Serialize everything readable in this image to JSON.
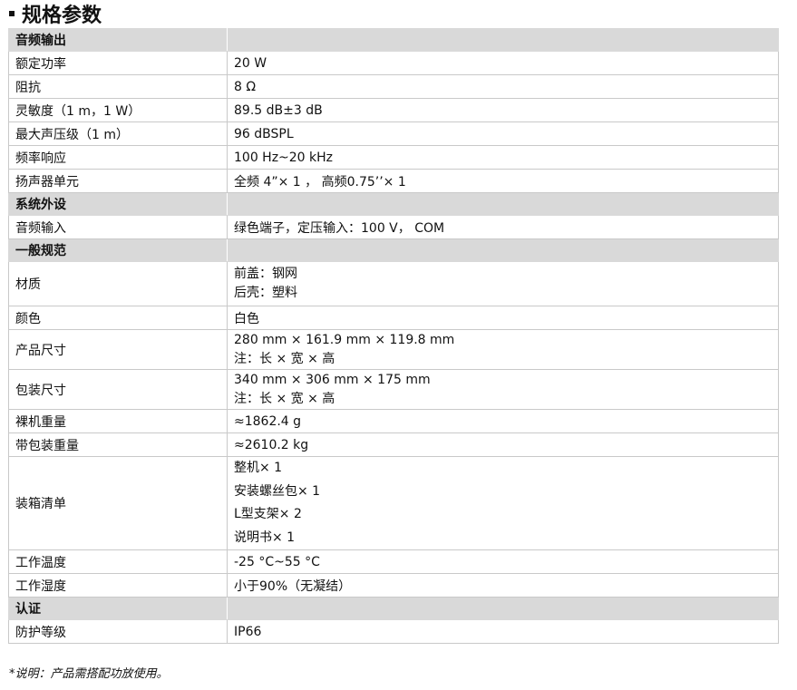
{
  "title": "规格参数",
  "sections": {
    "audio": {
      "header": "音频输出",
      "rated_power": {
        "label": "额定功率",
        "value": "20 W"
      },
      "impedance": {
        "label": "阻抗",
        "value": "8 Ω"
      },
      "sensitivity": {
        "label": "灵敏度（1 m，1 W）",
        "value": "89.5 dB±3 dB"
      },
      "max_spl": {
        "label": "最大声压级（1 m）",
        "value": "96 dBSPL"
      },
      "freq_response": {
        "label": "频率响应",
        "value": "100 Hz~20 kHz"
      },
      "speaker_unit": {
        "label": "扬声器单元",
        "value": "全频  4”× 1  ，  高频0.75’’× 1"
      }
    },
    "system": {
      "header": "系统外设",
      "audio_input": {
        "label": "音频输入",
        "value": "绿色端子，定压输入：100 V，  COM"
      }
    },
    "general": {
      "header": "一般规范",
      "material": {
        "label": "材质",
        "lines": [
          "前盖：钢网",
          "后壳：塑料"
        ]
      },
      "color": {
        "label": "颜色",
        "value": "白色"
      },
      "product_size": {
        "label": "产品尺寸",
        "lines": [
          "280 mm × 161.9 mm × 119.8 mm",
          "注：长 × 宽 × 高"
        ]
      },
      "package_size": {
        "label": "包装尺寸",
        "lines": [
          "340 mm × 306 mm × 175 mm",
          "注：长 × 宽 × 高"
        ]
      },
      "net_weight": {
        "label": "裸机重量",
        "value": "≈1862.4 g"
      },
      "gross_weight": {
        "label": "带包装重量",
        "value": "≈2610.2 kg"
      },
      "packing_list": {
        "label": "装箱清单",
        "lines": [
          "整机× 1",
          "安装螺丝包× 1",
          "L型支架× 2",
          "说明书× 1"
        ]
      },
      "work_temp": {
        "label": "工作温度",
        "value": "-25 °C~55 °C"
      },
      "work_humidity": {
        "label": "工作湿度",
        "value": "小于90%（无凝结）"
      }
    },
    "cert": {
      "header": "认证",
      "protection": {
        "label": "防护等级",
        "value": "IP66"
      }
    }
  },
  "footnote": "*说明：产品需搭配功放使用。"
}
